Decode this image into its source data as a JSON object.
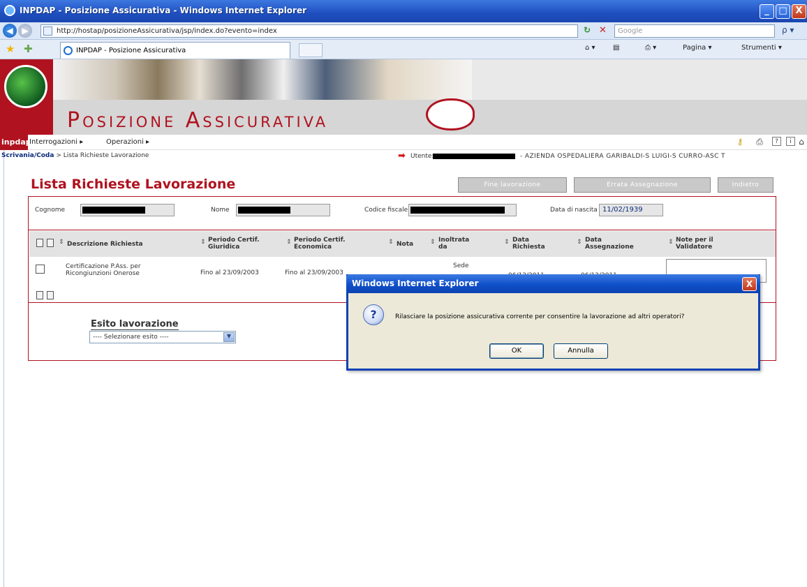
{
  "window": {
    "title": "INPDAP - Posizione Assicurativa - Windows Internet Explorer",
    "min": "_",
    "max": "□",
    "close": "X"
  },
  "address": {
    "url": "http://hostap/posizioneAssicurativa/jsp/index.do?evento=index",
    "search_placeholder": "Google",
    "search_btn": "ρ ▾"
  },
  "tab": {
    "label": "INPDAP - Posizione Assicurativa"
  },
  "toolbar": {
    "home": "⌂ ▾",
    "feeds": "▤",
    "print": "⎙ ▾",
    "pagina": "Pagina ▾",
    "strumenti": "Strumenti ▾"
  },
  "banner": {
    "heading": "Posizione Assicurativa",
    "logo": "inpdap"
  },
  "menu": {
    "interrogazioni": "Interrogazioni ▸",
    "operazioni": "Operazioni ▸",
    "icons": [
      "key-icon",
      "print-icon",
      "help-icon",
      "info-icon",
      "sitemap-icon"
    ]
  },
  "breadcrumb": {
    "root": "Scrivania/Coda",
    "current": "> Lista Richieste Lavorazione"
  },
  "user": {
    "label": "Utente:",
    "org": "- AZIENDA OSPEDALIERA GARIBALDI-S LUIGI-S CURRO-ASC T"
  },
  "page": {
    "title": "Lista Richieste Lavorazione",
    "buttons": {
      "fine": "Fine lavorazione",
      "errata": "Errata Assegnazione",
      "indietro": "Indietro"
    }
  },
  "search": {
    "cognome_label": "Cognome",
    "nome_label": "Nome",
    "codice_label": "Codice fiscale",
    "nascita_label": "Data di nascita",
    "nascita_value": "11/02/1939"
  },
  "table": {
    "headers": {
      "descrizione": "Descrizione Richiesta",
      "giuridica_1": "Periodo Certif.",
      "giuridica_2": "Giuridica",
      "economica_1": "Periodo Certif.",
      "economica_2": "Economica",
      "nota": "Nota",
      "inoltrata_1": "Inoltrata",
      "inoltrata_2": "da",
      "richiesta_1": "Data",
      "richiesta_2": "Richiesta",
      "assegnazione_1": "Data",
      "assegnazione_2": "Assegnazione",
      "validatore_1": "Note per il",
      "validatore_2": "Validatore"
    },
    "rows": [
      {
        "descrizione_1": "Certificazione P.Ass. per",
        "descrizione_2": "Ricongiunzioni Onerose",
        "giuridica": "Fino al 23/09/2003",
        "economica": "Fino al 23/09/2003",
        "inoltrata": "Sede",
        "richiesta": "06/12/2011",
        "assegnazione": "06/12/2011"
      }
    ]
  },
  "esito": {
    "label": "Esito lavorazione",
    "selected": "---- Selezionare esito ----"
  },
  "dialog": {
    "title": "Windows Internet Explorer",
    "icon": "?",
    "message": "Rilasciare la posizione assicurativa corrente per consentire la lavorazione ad altri operatori?",
    "ok": "OK",
    "cancel": "Annulla",
    "close": "X"
  }
}
